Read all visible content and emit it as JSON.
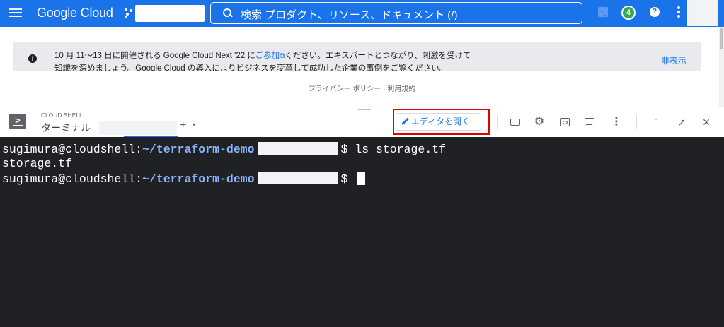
{
  "header": {
    "logo": "Google Cloud",
    "search_placeholder": "検索 プロダクト、リソース、ドキュメント (/)",
    "notifications_count": "4",
    "shell_icon": "cloud-shell-icon",
    "help_icon": "?"
  },
  "banner": {
    "line1_before": "10 月 11〜13 日に開催される Google Cloud Next '22 に",
    "line1_link": "ご参加",
    "line1_after": "ください。エキスパートとつながり、刺激を受けて",
    "line2": "知識を深めましょう。Google Cloud の導入によりビジネスを変革して成功した企業の事例をご覧ください。",
    "hide_label": "非表示"
  },
  "footer_links": "プライバシー ポリシー · 利用規約",
  "cloud_shell": {
    "section_label": "CLOUD SHELL",
    "tab_label": "ターミナル",
    "add_tab": "+",
    "tab_caret": "▾",
    "open_editor_label": "エディタを開く",
    "tools": {
      "more": "⋮",
      "restore": "⌃",
      "open_new": "↗",
      "close": "✕"
    }
  },
  "terminal": {
    "user_host": "sugimura@cloudshell:",
    "path": "~/terraform-demo",
    "prompt_symbol": "$",
    "command1": "ls storage.tf",
    "output1": "storage.tf"
  },
  "colors": {
    "brand_blue": "#1a73e8",
    "terminal_bg": "#202124",
    "path_color": "#8ab4f8",
    "highlight_red": "#e00000"
  }
}
